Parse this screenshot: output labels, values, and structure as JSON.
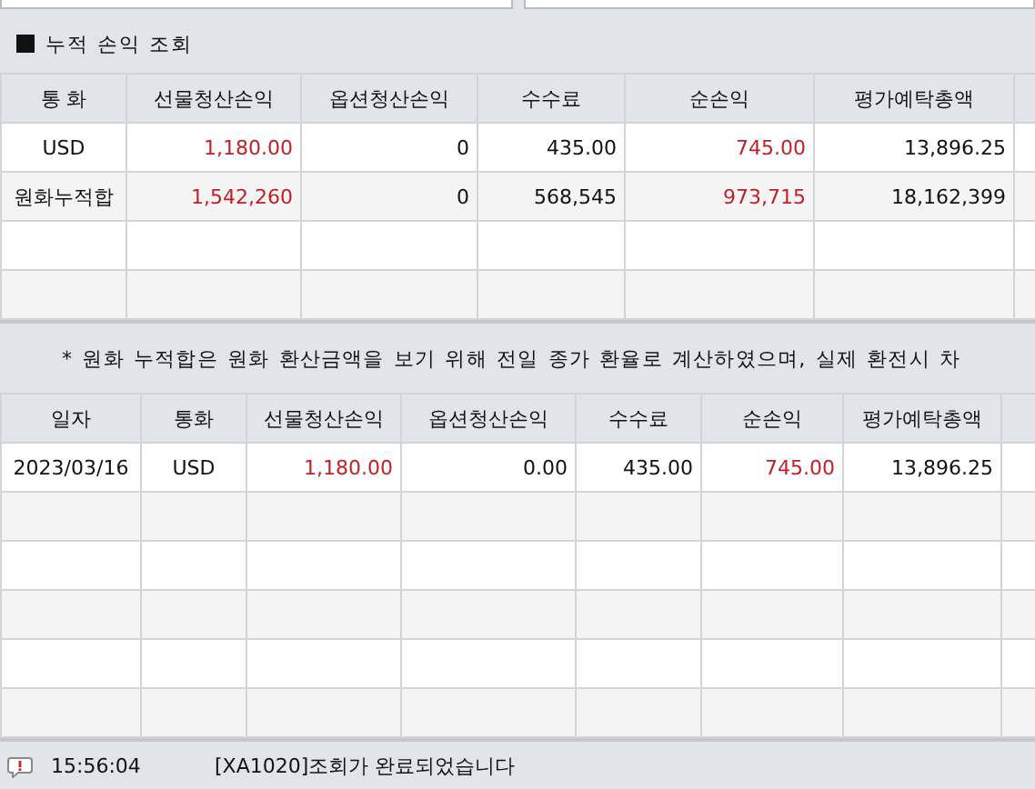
{
  "section_title": "누적 손익 조회",
  "summary_table": {
    "columns": [
      {
        "label": "통 화",
        "emphasized": false
      },
      {
        "label": "선물청산손익",
        "emphasized": true
      },
      {
        "label": "옵션청산손익",
        "emphasized": false
      },
      {
        "label": "수수료",
        "emphasized": false
      },
      {
        "label": "순손익",
        "emphasized": true
      },
      {
        "label": "평가예탁총액",
        "emphasized": false
      }
    ],
    "rows": [
      [
        "USD",
        "1,180.00",
        "0",
        "435.00",
        "745.00",
        "13,896.25"
      ],
      [
        "원화누적합",
        "1,542,260",
        "0",
        "568,545",
        "973,715",
        "18,162,399"
      ]
    ]
  },
  "note": "* 원화 누적합은 원화 환산금액을 보기 위해 전일 종가 환율로 계산하였으며, 실제 환전시 차",
  "daily_table": {
    "columns": [
      {
        "label": "일자",
        "emphasized": false
      },
      {
        "label": "통화",
        "emphasized": false
      },
      {
        "label": "선물청산손익",
        "emphasized": true
      },
      {
        "label": "옵션청산손익",
        "emphasized": false
      },
      {
        "label": "수수료",
        "emphasized": false
      },
      {
        "label": "순손익",
        "emphasized": true
      },
      {
        "label": "평가예탁총액",
        "emphasized": false
      }
    ],
    "rows": [
      [
        "2023/03/16",
        "USD",
        "1,180.00",
        "0.00",
        "435.00",
        "745.00",
        "13,896.25"
      ]
    ]
  },
  "status_bar": {
    "time": "15:56:04",
    "message": "[XA1020]조회가 완료되었습니다"
  }
}
